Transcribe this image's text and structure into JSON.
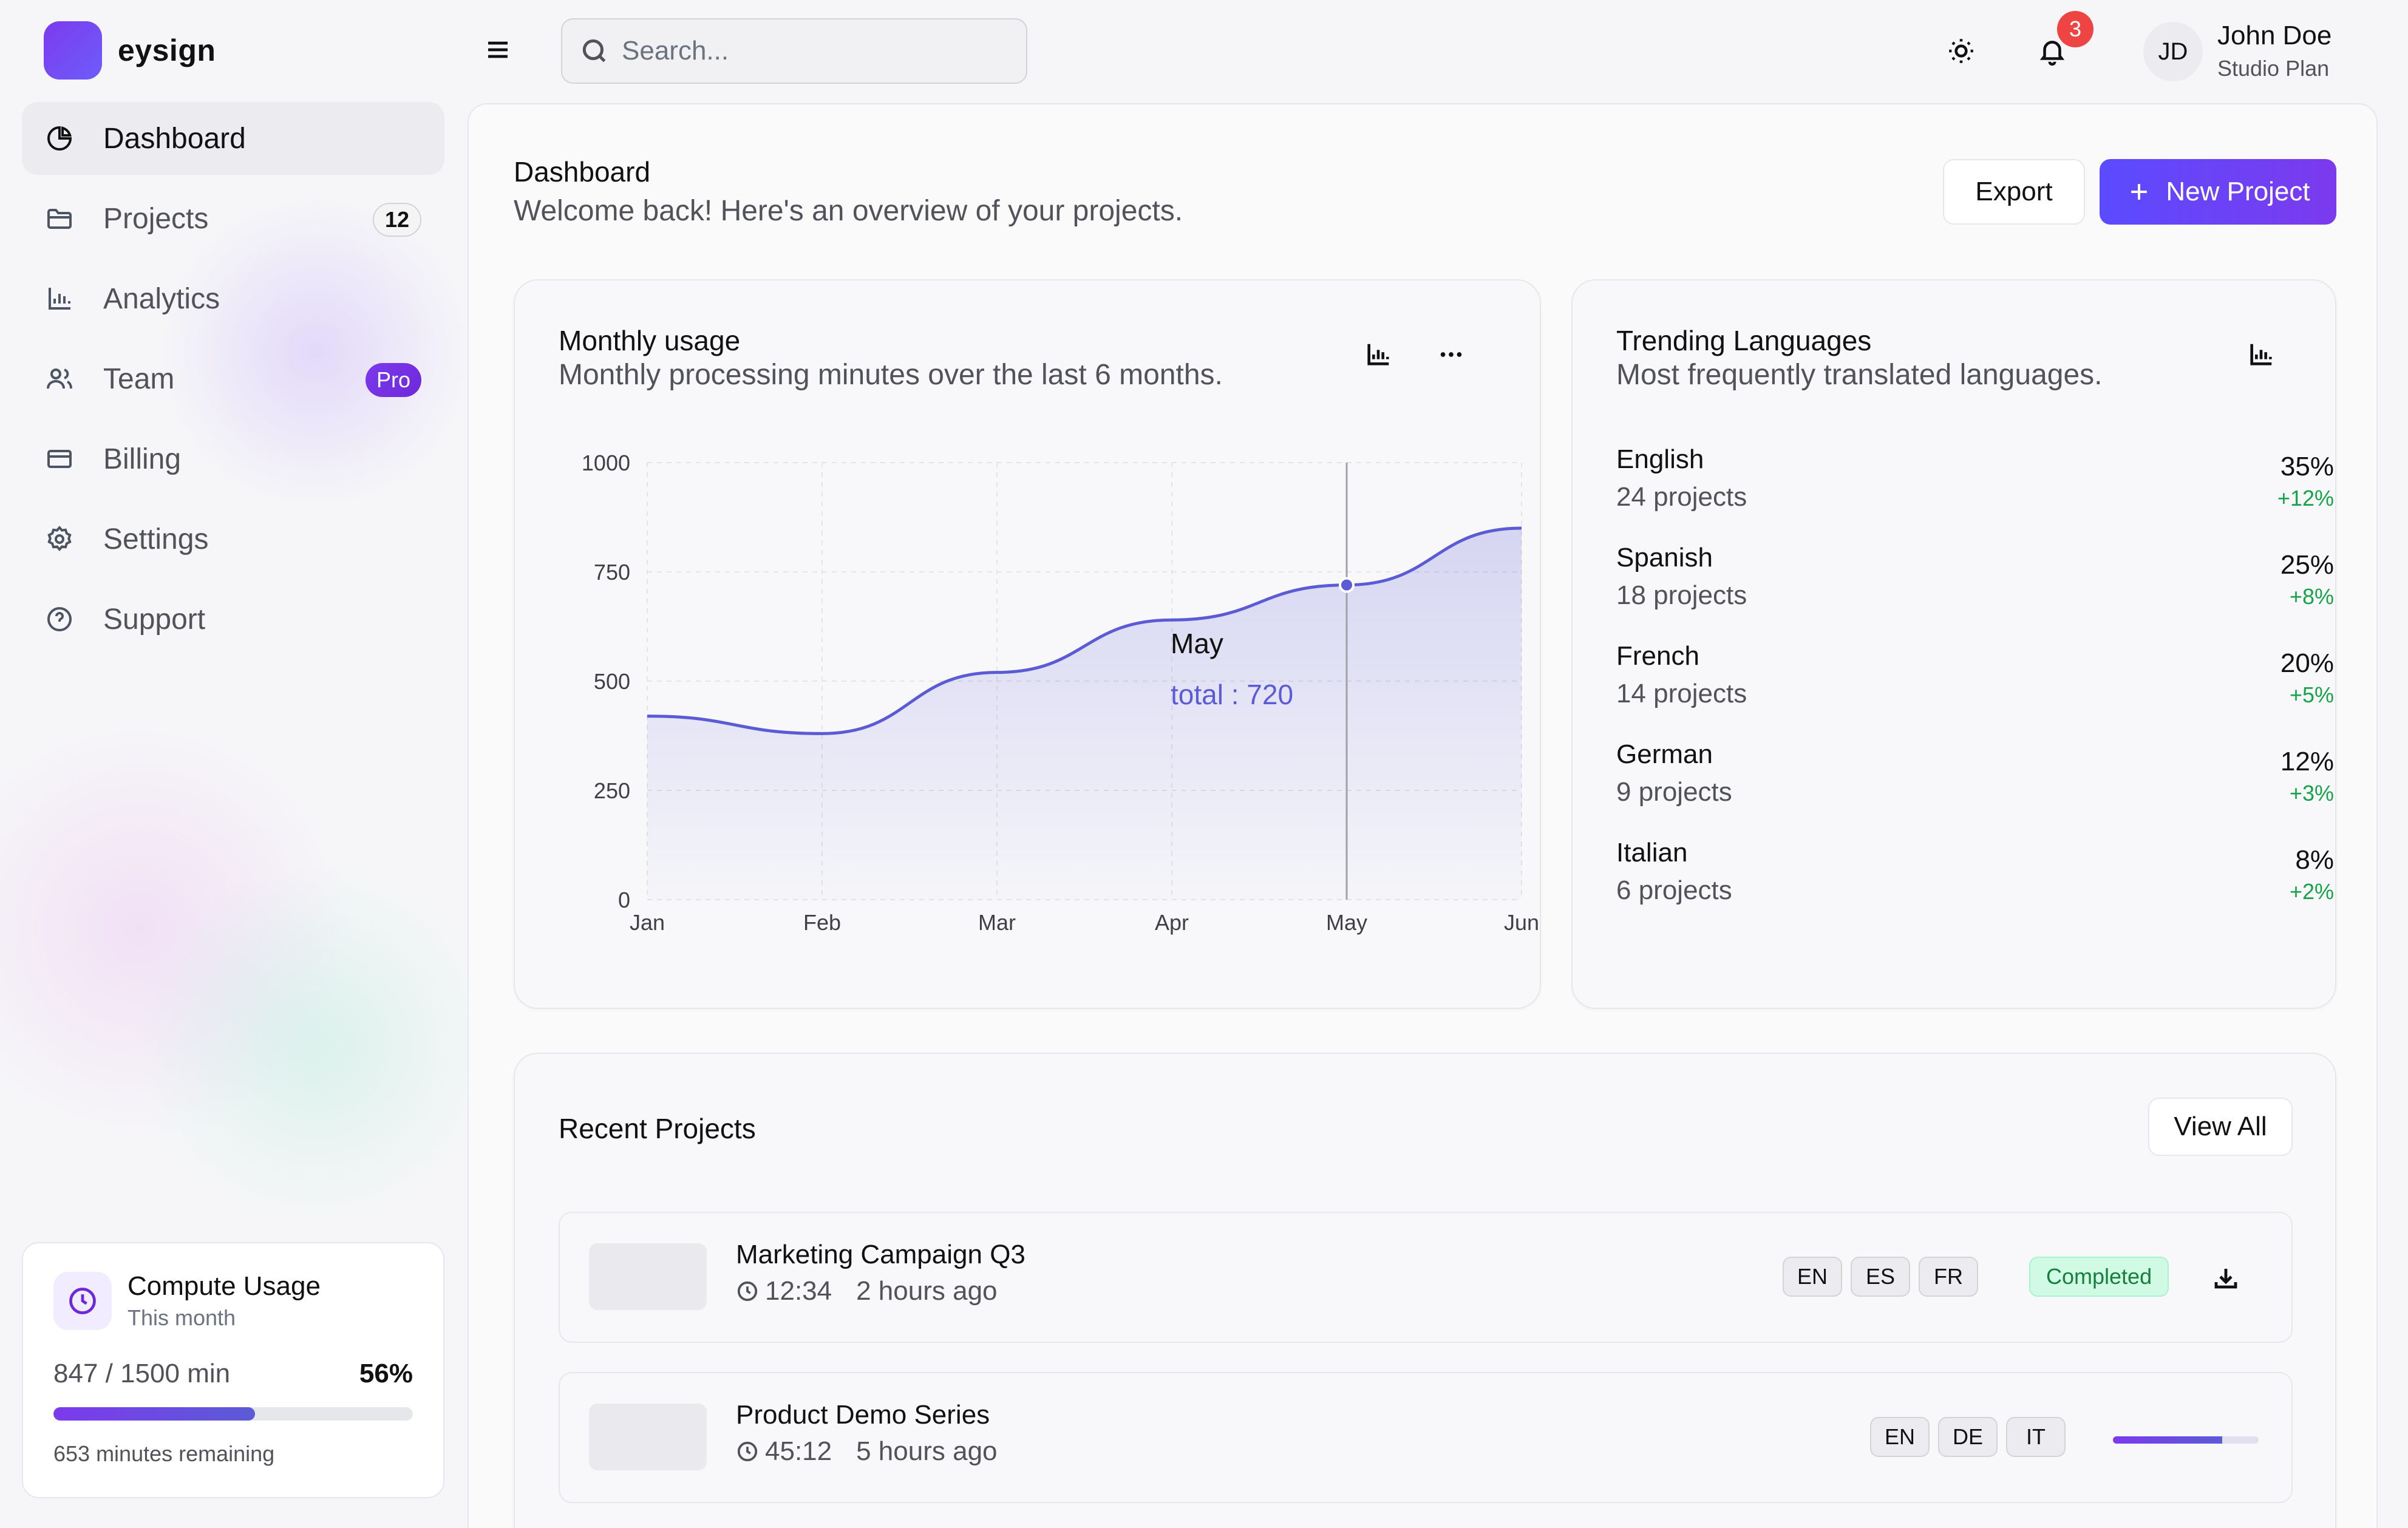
{
  "brand": {
    "name": "eysign"
  },
  "sidebar": {
    "items": [
      {
        "label": "Dashboard",
        "icon": "pie-chart-icon",
        "active": true,
        "badge": ""
      },
      {
        "label": "Projects",
        "icon": "folder-icon",
        "active": false,
        "badge": "12"
      },
      {
        "label": "Analytics",
        "icon": "bar-chart-icon",
        "active": false,
        "badge": ""
      },
      {
        "label": "Team",
        "icon": "users-icon",
        "active": false,
        "badge": "Pro"
      },
      {
        "label": "Billing",
        "icon": "credit-card-icon",
        "active": false,
        "badge": ""
      },
      {
        "label": "Settings",
        "icon": "gear-icon",
        "active": false,
        "badge": ""
      },
      {
        "label": "Support",
        "icon": "help-circle-icon",
        "active": false,
        "badge": ""
      }
    ],
    "usage": {
      "title": "Compute Usage",
      "subtitle": "This month",
      "minutes": "847 / 1500 min",
      "percent": "56%",
      "fraction": 0.56,
      "remaining": "653 minutes remaining"
    }
  },
  "header": {
    "search_placeholder": "Search...",
    "notifications": "3",
    "user": {
      "initials": "JD",
      "name": "John Doe",
      "plan": "Studio Plan"
    }
  },
  "main": {
    "title": "Dashboard",
    "subtitle": "Welcome back! Here's an overview of your projects.",
    "export_label": "Export",
    "new_project_label": "New Project"
  },
  "usage_card": {
    "title": "Monthly usage",
    "subtitle": "Monthly processing minutes over the last 6 months.",
    "tooltip": {
      "label": "May",
      "text": "total : 720"
    }
  },
  "chart_data": {
    "type": "area",
    "categories": [
      "Jan",
      "Feb",
      "Mar",
      "Apr",
      "May",
      "Jun"
    ],
    "series": [
      {
        "values": [
          420,
          380,
          520,
          640,
          720,
          850
        ]
      }
    ],
    "yticks": [
      0,
      250,
      500,
      750,
      1000
    ],
    "ylim": [
      0,
      1000
    ],
    "grid": true,
    "highlight": {
      "category": "May",
      "value": 720
    },
    "color": "#5b5bd6"
  },
  "languages": {
    "title": "Trending Languages",
    "subtitle": "Most frequently translated languages.",
    "items": [
      {
        "name": "English",
        "projects": "24 projects",
        "percent": "35%",
        "delta": "+12%"
      },
      {
        "name": "Spanish",
        "projects": "18 projects",
        "percent": "25%",
        "delta": "+8%"
      },
      {
        "name": "French",
        "projects": "14 projects",
        "percent": "20%",
        "delta": "+5%"
      },
      {
        "name": "German",
        "projects": "9 projects",
        "percent": "12%",
        "delta": "+3%"
      },
      {
        "name": "Italian",
        "projects": "6 projects",
        "percent": "8%",
        "delta": "+2%"
      }
    ]
  },
  "recent": {
    "title": "Recent Projects",
    "view_all": "View All",
    "projects": [
      {
        "name": "Marketing Campaign Q3",
        "duration": "12:34",
        "ago": "2 hours ago",
        "langs": [
          "EN",
          "ES",
          "FR"
        ],
        "status": "Completed"
      },
      {
        "name": "Product Demo Series",
        "duration": "45:12",
        "ago": "5 hours ago",
        "langs": [
          "EN",
          "DE",
          "IT"
        ],
        "progress": 0.75
      }
    ]
  }
}
